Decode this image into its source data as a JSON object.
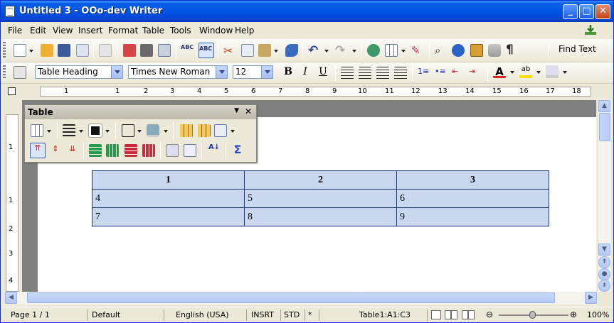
{
  "window": {
    "title": "Untitled 3 - OOo-dev Writer"
  },
  "menu": [
    "File",
    "Edit",
    "View",
    "Insert",
    "Format",
    "Table",
    "Tools",
    "Window",
    "Help"
  ],
  "toolbar_standard": {
    "find_text_label": "Find Text"
  },
  "toolbar_formatting": {
    "paragraph_style": "Table Heading",
    "font_name": "Times New Roman",
    "font_size": "12",
    "bold_label": "B",
    "italic_label": "I",
    "underline_label": "U"
  },
  "ruler": {
    "h_numbers": [
      "1",
      "1",
      "2",
      "3",
      "4",
      "5",
      "6",
      "7",
      "8",
      "9",
      "10",
      "11",
      "12",
      "13",
      "14",
      "15",
      "16",
      "17",
      "18"
    ],
    "v_numbers": [
      "1",
      "1",
      "2",
      "3",
      "4"
    ]
  },
  "table_toolbar": {
    "title": "Table"
  },
  "document_table": {
    "rows": [
      [
        "1",
        "2",
        "3"
      ],
      [
        "4",
        "5",
        "6"
      ],
      [
        "7",
        "8",
        "9"
      ]
    ]
  },
  "status": {
    "page": "Page 1 / 1",
    "style": "Default",
    "language": "English (USA)",
    "insert_mode": "INSRT",
    "selection_mode": "STD",
    "modified": "*",
    "cell_ref": "Table1:A1:C3",
    "zoom": "100%"
  },
  "colors": {
    "titlebar": "#0054e3",
    "table_cell": "#c9d7ef",
    "table_border": "#1e3b7a"
  }
}
